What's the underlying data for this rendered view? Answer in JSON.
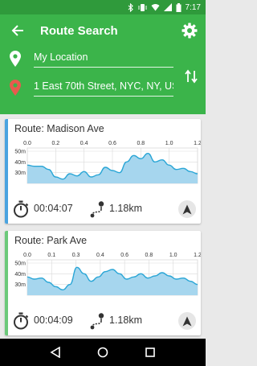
{
  "status_bar": {
    "time": "7:17"
  },
  "header": {
    "title": "Route Search",
    "origin_value": "My Location",
    "destination_value": "1 East 70th Street, NYC, NY, US",
    "origin_pin_color": "#ffffff",
    "destination_pin_color": "#e95a4e",
    "background": "#3bb44a"
  },
  "routes": [
    {
      "title": "Route: Madison Ave",
      "accent": "#4aa3e0",
      "duration": "00:04:07",
      "distance": "1.18km",
      "chart_data": {
        "type": "area",
        "x_ticks": [
          "0.0",
          "0.2",
          "0.4",
          "0.6",
          "0.8",
          "1.0",
          "1.2"
        ],
        "y_ticks": [
          "50m",
          "40m",
          "30m"
        ],
        "xlim": [
          0,
          1.2
        ],
        "ylim": [
          20,
          53
        ],
        "x": [
          0,
          0.05,
          0.1,
          0.15,
          0.2,
          0.25,
          0.3,
          0.35,
          0.4,
          0.45,
          0.5,
          0.55,
          0.6,
          0.65,
          0.7,
          0.75,
          0.8,
          0.85,
          0.9,
          0.95,
          1.0,
          1.05,
          1.1,
          1.15,
          1.2
        ],
        "y": [
          37,
          36,
          36,
          33,
          26,
          24,
          29,
          27,
          31,
          26,
          28,
          35,
          32,
          30,
          40,
          46,
          43,
          48,
          40,
          42,
          37,
          33,
          34,
          31,
          29
        ]
      }
    },
    {
      "title": "Route: Park Ave",
      "accent": "#6cc97a",
      "duration": "00:04:09",
      "distance": "1.18km",
      "chart_data": {
        "type": "area",
        "x_ticks": [
          "0.0",
          "0.1",
          "0.3",
          "0.4",
          "0.6",
          "0.8",
          "1.0",
          "1.2"
        ],
        "y_ticks": [
          "50m",
          "40m",
          "30m"
        ],
        "xlim": [
          0,
          1.2
        ],
        "ylim": [
          20,
          53
        ],
        "x": [
          0,
          0.05,
          0.1,
          0.15,
          0.2,
          0.25,
          0.3,
          0.35,
          0.4,
          0.45,
          0.5,
          0.55,
          0.6,
          0.65,
          0.7,
          0.75,
          0.8,
          0.85,
          0.9,
          0.95,
          1.0,
          1.05,
          1.1,
          1.15,
          1.2
        ],
        "y": [
          37,
          35,
          36,
          32,
          28,
          25,
          30,
          46,
          40,
          33,
          37,
          42,
          44,
          40,
          35,
          37,
          40,
          36,
          38,
          41,
          38,
          35,
          36,
          33,
          30
        ]
      }
    }
  ],
  "colors": {
    "line": "#2aa6d6",
    "fill": "#a6d6ee",
    "grid": "#d9d9d9"
  }
}
